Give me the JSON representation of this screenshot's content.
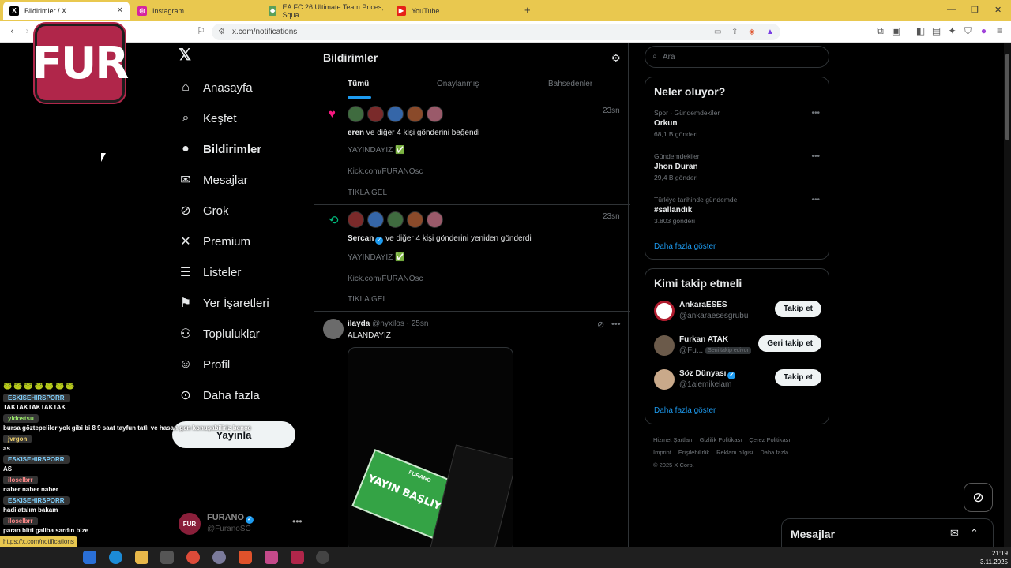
{
  "browser": {
    "tabs": [
      {
        "label": "Bildirimler / X",
        "active": true,
        "icon": "x-logo-icon"
      },
      {
        "label": "Instagram",
        "active": false,
        "icon": "instagram-icon"
      },
      {
        "label": "EA FC 26 Ultimate Team Prices, Squa",
        "active": false,
        "icon": "futbin-icon"
      },
      {
        "label": "YouTube",
        "active": false,
        "icon": "youtube-icon"
      }
    ],
    "url": "x.com/notifications",
    "status_url": "https://x.com/notifications"
  },
  "overlay": {
    "logo_text": "FUR",
    "chat": {
      "frogs": "🐸🐸🐸🐸🐸🐸🐸",
      "messages": [
        {
          "user": "ESKISEHIRSPORR",
          "text": "TAKTAKTAKTAKTAK"
        },
        {
          "user": "yldostsu",
          "text": "bursa göztepeliler yok gibi bi 8 9 saat tayfun tatlı ve hasan gen konuşabiliriz bence"
        },
        {
          "user": "jvrgon",
          "text": "as"
        },
        {
          "user": "ESKISEHIRSPORR",
          "text": "AS"
        },
        {
          "user": "iloselbrr",
          "text": "naber naber naber"
        },
        {
          "user": "ESKISEHIRSPORR",
          "text": "hadi atalım bakam"
        },
        {
          "user": "iloselbrr",
          "text": "paran bitti galiba sardın bize"
        }
      ]
    }
  },
  "nav": {
    "items": [
      {
        "label": "Anasayfa",
        "icon": "home-icon",
        "glyph": "⌂"
      },
      {
        "label": "Keşfet",
        "icon": "search-icon",
        "glyph": "⌕"
      },
      {
        "label": "Bildirimler",
        "icon": "bell-icon",
        "glyph": "🔔",
        "active": true
      },
      {
        "label": "Mesajlar",
        "icon": "mail-icon",
        "glyph": "✉"
      },
      {
        "label": "Grok",
        "icon": "grok-icon",
        "glyph": "⊘"
      },
      {
        "label": "Premium",
        "icon": "x-premium-icon",
        "glyph": "𝕏"
      },
      {
        "label": "Listeler",
        "icon": "list-icon",
        "glyph": "☰"
      },
      {
        "label": "Yer İşaretleri",
        "icon": "bookmark-icon",
        "glyph": "🔖"
      },
      {
        "label": "Topluluklar",
        "icon": "communities-icon",
        "glyph": "👥"
      },
      {
        "label": "Profil",
        "icon": "profile-icon",
        "glyph": "👤"
      },
      {
        "label": "Daha fazla",
        "icon": "more-circle-icon",
        "glyph": "⋯"
      }
    ],
    "post_button": "Yayınla",
    "profile": {
      "name": "FURANO",
      "handle": "@FuranoSC",
      "avatar_text": "FUR"
    }
  },
  "main": {
    "title": "Bildirimler",
    "tabs": [
      "Tümü",
      "Onaylanmış",
      "Bahsedenler"
    ],
    "notifications": [
      {
        "kind": "like",
        "time": "23sn",
        "actor": "eren",
        "action": "ve diğer 4 kişi gönderini beğendi",
        "lines": [
          "YAYINDAYIZ ✅",
          "Kick.com/FURANOsc",
          "TIKLA GEL"
        ]
      },
      {
        "kind": "repost",
        "time": "23sn",
        "actor": "Sercan",
        "action": "ve diğer 4 kişi gönderini yeniden gönderdi",
        "lines": [
          "YAYINDAYIZ ✅",
          "Kick.com/FURANOsc",
          "TIKLA GEL"
        ]
      }
    ],
    "tweet": {
      "name": "ilayda",
      "handle": "@nyxilos · 25sn",
      "text": "ALANDAYIZ",
      "media_banner": "YAYIN BAŞLIYOR",
      "media_top": "FURANO"
    }
  },
  "right": {
    "search_placeholder": "Ara",
    "trends_title": "Neler oluyor?",
    "trends": [
      {
        "category": "Spor · Gündemdekiler",
        "title": "Orkun",
        "count": "68,1 B gönderi"
      },
      {
        "category": "Gündemdekiler",
        "title": "Jhon Duran",
        "count": "29,4 B gönderi"
      },
      {
        "category": "Türkiye tarihinde gündemde",
        "title": "#sallandık",
        "count": "3.803 gönderi"
      }
    ],
    "trends_more": "Daha fazla göster",
    "follow_title": "Kimi takip etmeli",
    "follow": [
      {
        "name": "AnkaraESES",
        "handle": "@ankaraesesgrubu",
        "button": "Takip et",
        "verified": false,
        "badge": ""
      },
      {
        "name": "Furkan ATAK",
        "handle": "@Fu...",
        "button": "Geri takip et",
        "verified": false,
        "badge": "Seni takip ediyor"
      },
      {
        "name": "Söz Dünyası",
        "handle": "@1alemikelam",
        "button": "Takip et",
        "verified": true,
        "badge": ""
      }
    ],
    "follow_more": "Daha fazla göster",
    "footer": [
      "Hizmet Şartları",
      "Gizlilik Politikası",
      "Çerez Politikası",
      "Imprint",
      "Erişilebilirlik",
      "Reklam bilgisi",
      "Daha fazla ...",
      "© 2025 X Corp."
    ]
  },
  "dock": {
    "title": "Mesajlar"
  },
  "taskbar": {
    "time": "21:19",
    "date": "3.11.2025"
  },
  "colors": {
    "accent": "#1d9bf0",
    "like": "#f91880",
    "repost": "#00ba7c",
    "tabbar": "#e9c84f"
  }
}
